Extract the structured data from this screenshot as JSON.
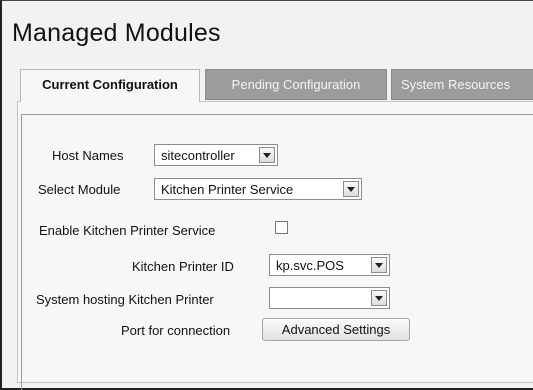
{
  "page": {
    "title": "Managed Modules"
  },
  "tabs": [
    {
      "label": "Current Configuration",
      "active": true
    },
    {
      "label": "Pending Configuration",
      "active": false
    },
    {
      "label": "System Resources",
      "active": false
    }
  ],
  "form": {
    "host_names": {
      "label": "Host Names",
      "value": "sitecontroller"
    },
    "select_module": {
      "label": "Select Module",
      "value": "Kitchen Printer Service"
    },
    "enable_service": {
      "label": "Enable Kitchen Printer Service",
      "checked": false
    },
    "printer_id": {
      "label": "Kitchen Printer ID",
      "value": "kp.svc.POS"
    },
    "hosting_system": {
      "label": "System hosting Kitchen Printer",
      "value": ""
    },
    "port": {
      "label": "Port for connection",
      "button_label": "Advanced Settings"
    }
  },
  "icons": {
    "dropdown": "chevron-down-icon"
  }
}
